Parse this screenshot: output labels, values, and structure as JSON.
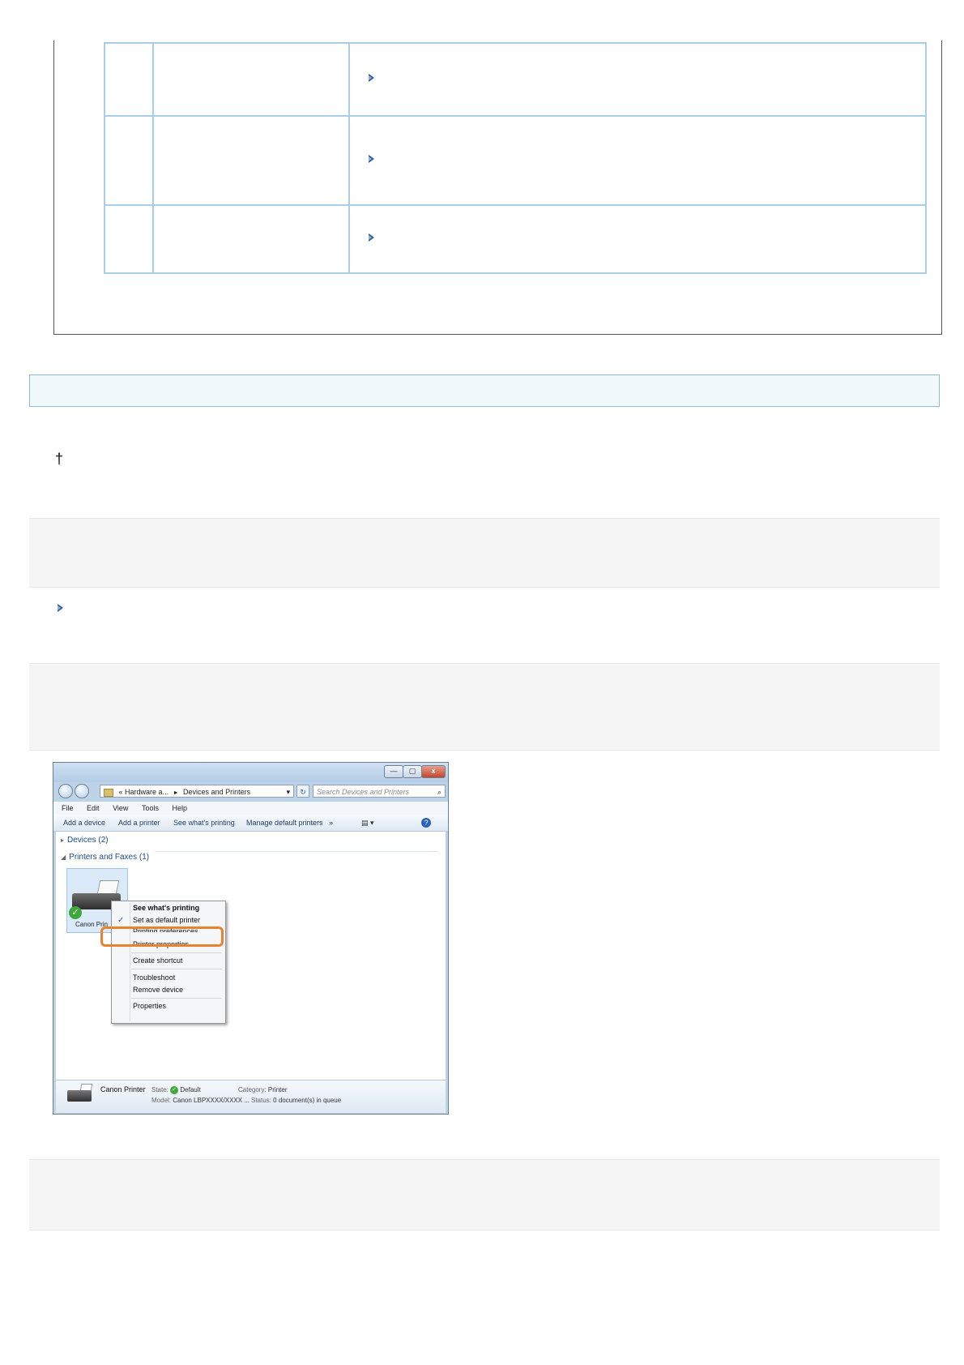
{
  "colors": {
    "table_border": "#a9cfe6",
    "section_bar_bg": "#f2f9fc",
    "band_bg": "#f5f5f5",
    "link_arrow": "#2f5d9c",
    "highlight_orange": "#e8822d"
  },
  "note_marker": "†",
  "screenshot": {
    "caption_buttons": {
      "minimize": "—",
      "maximize": "▢",
      "close": "x"
    },
    "address_bar": {
      "prefix": "«",
      "crumb1": "Hardware a...",
      "separator": "►",
      "crumb2": "Devices and Printers"
    },
    "search_placeholder": "Search Devices and Printers",
    "menu": [
      "File",
      "Edit",
      "View",
      "Tools",
      "Help"
    ],
    "commands": [
      "Add a device",
      "Add a printer",
      "See what's printing",
      "Manage default printers",
      "»"
    ],
    "groups": {
      "devices": "Devices (2)",
      "printers": "Printers and Faxes (1)"
    },
    "printer_label": "Canon Prin",
    "context_menu": [
      "See what's printing",
      "Set as default printer",
      "Printing preferences",
      "Printer properties",
      "Create shortcut",
      "Troubleshoot",
      "Remove device",
      "Properties"
    ],
    "details": {
      "name": "Canon Printer",
      "state_label": "State:",
      "state_value": "Default",
      "model_label": "Model:",
      "model_value": "Canon LBPXXXX/XXXX ...",
      "category_label": "Category:",
      "category_value": "Printer",
      "status_label": "Status:",
      "status_value": "0 document(s) in queue"
    }
  }
}
